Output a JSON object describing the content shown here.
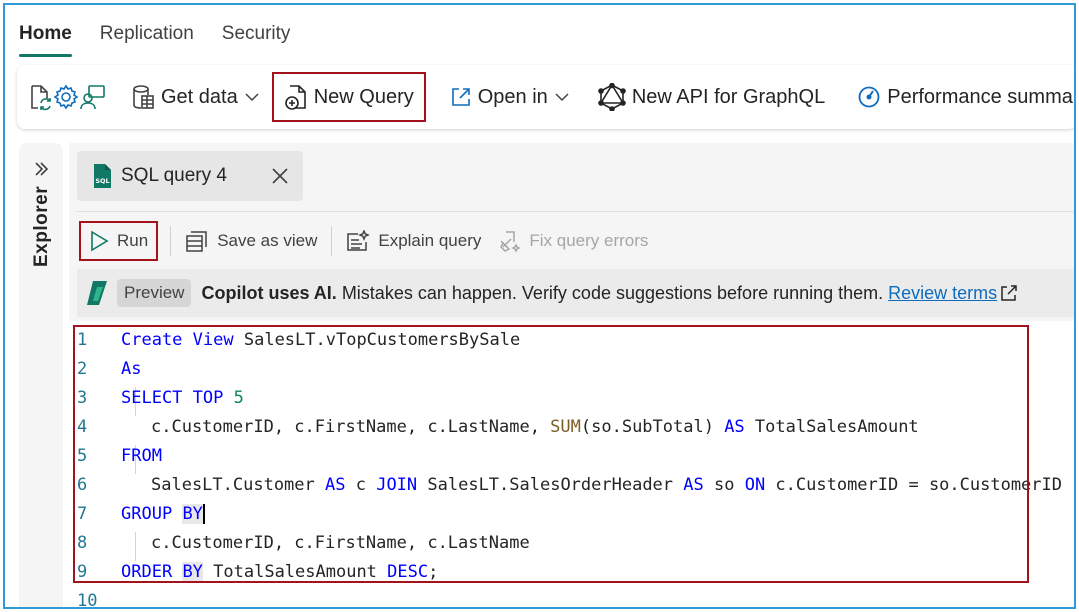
{
  "top_tabs": [
    {
      "label": "Home",
      "active": true
    },
    {
      "label": "Replication",
      "active": false
    },
    {
      "label": "Security",
      "active": false
    }
  ],
  "ribbon": {
    "get_data": "Get data",
    "new_query": "New Query",
    "open_in": "Open in",
    "new_api": "New API for GraphQL",
    "performance_summary": "Performance summary"
  },
  "explorer": {
    "label": "Explorer"
  },
  "query_tab": {
    "label": "SQL query 4",
    "icon_text": "SQL"
  },
  "editor_toolbar": {
    "run": "Run",
    "save_as_view": "Save as view",
    "explain_query": "Explain query",
    "fix_query_errors": "Fix query errors"
  },
  "copilot": {
    "preview": "Preview",
    "strong": "Copilot uses AI.",
    "text": "Mistakes can happen. Verify code suggestions before running them.",
    "link": "Review terms"
  },
  "code": {
    "line_numbers": [
      "1",
      "2",
      "3",
      "4",
      "5",
      "6",
      "7",
      "8",
      "9",
      "10"
    ],
    "l1": {
      "kw1": "Create",
      "kw2": "View",
      "rest": " SalesLT.vTopCustomersBySale"
    },
    "l2": {
      "kw": "As"
    },
    "l3": {
      "kw1": "SELECT",
      "kw2": "TOP",
      "num": "5"
    },
    "l4": {
      "a": "c.CustomerID, c.FirstName, c.LastName, ",
      "fn": "SUM",
      "b": "(so.SubTotal) ",
      "kw": "AS",
      "c": " TotalSalesAmount"
    },
    "l5": {
      "kw": "FROM"
    },
    "l6": {
      "a": "SalesLT.Customer ",
      "kw1": "AS",
      "b": " c ",
      "kw2": "JOIN",
      "c": " SalesLT.SalesOrderHeader ",
      "kw3": "AS",
      "d": " so ",
      "kw4": "ON",
      "e": " c.CustomerID = so.CustomerID"
    },
    "l7": {
      "kw1": "GROUP",
      "kw2": "BY"
    },
    "l8": {
      "a": "c.CustomerID, c.FirstName, c.LastName"
    },
    "l9": {
      "kw1": "ORDER",
      "kw2": "BY",
      "a": " TotalSalesAmount ",
      "kw3": "DESC",
      "b": ";"
    }
  }
}
